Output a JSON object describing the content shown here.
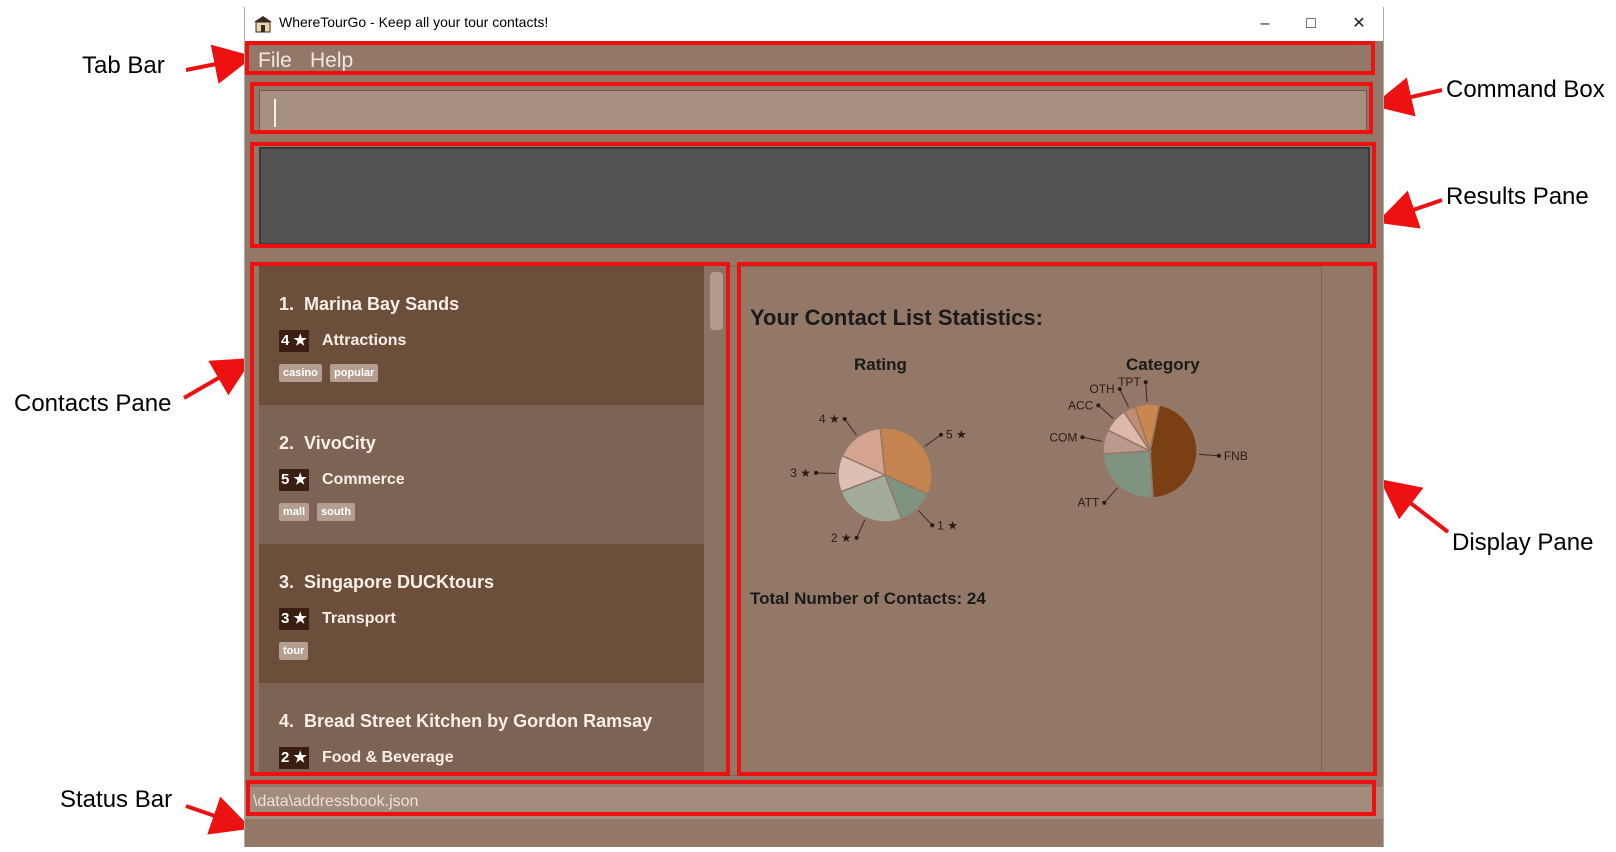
{
  "window": {
    "title": "WhereTourGo - Keep all your tour contacts!"
  },
  "menu": {
    "file": "File",
    "help": "Help"
  },
  "status": {
    "path": "\\data\\addressbook.json"
  },
  "annotations": {
    "tab_bar": "Tab Bar",
    "command_box": "Command Box",
    "results_pane": "Results Pane",
    "contacts_pane": "Contacts Pane",
    "display_pane": "Display Pane",
    "status_bar": "Status Bar"
  },
  "contacts": [
    {
      "index": "1.",
      "name": "Marina Bay Sands",
      "rating": "4 ★",
      "category": "Attractions",
      "tags": [
        "casino",
        "popular"
      ]
    },
    {
      "index": "2.",
      "name": "VivoCity",
      "rating": "5 ★",
      "category": "Commerce",
      "tags": [
        "mall",
        "south"
      ]
    },
    {
      "index": "3.",
      "name": "Singapore DUCKtours",
      "rating": "3 ★",
      "category": "Transport",
      "tags": [
        "tour"
      ]
    },
    {
      "index": "4.",
      "name": "Bread Street Kitchen by Gordon Ramsay",
      "rating": "2 ★",
      "category": "Food & Beverage",
      "tags": []
    }
  ],
  "display": {
    "title": "Your Contact List Statistics:",
    "rating_chart_title": "Rating",
    "category_chart_title": "Category",
    "total": "Total Number of Contacts: 24"
  },
  "colors": {
    "highlight": "#ee1111",
    "bg": "#937868",
    "card_dark": "#6b4f3b",
    "card_light": "#7d6353"
  },
  "chart_data": [
    {
      "type": "pie",
      "title": "Rating",
      "labels": [
        "5 ★",
        "1 ★",
        "2 ★",
        "3 ★",
        "4 ★"
      ],
      "values": [
        8,
        3,
        6,
        3,
        4
      ],
      "colors": [
        "#c4834f",
        "#7f9480",
        "#a3ab9c",
        "#dcc0b4",
        "#d4a392"
      ]
    },
    {
      "type": "pie",
      "title": "Category",
      "labels": [
        "FNB",
        "ATT",
        "COM",
        "ACC",
        "OTH",
        "TPT"
      ],
      "values": [
        11,
        6,
        2,
        2,
        1,
        2
      ],
      "colors": [
        "#7a3f12",
        "#7f9480",
        "#b99a8c",
        "#deb9a9",
        "#c08d70",
        "#c8874f"
      ]
    }
  ]
}
